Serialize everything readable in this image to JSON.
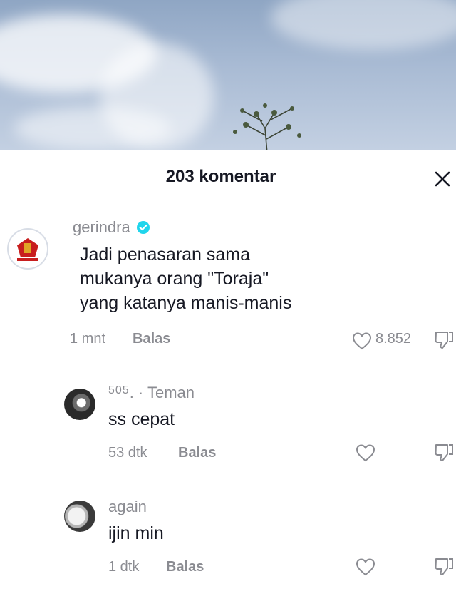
{
  "header": {
    "title": "203 komentar",
    "close_icon": "close-icon"
  },
  "comments": [
    {
      "username": "gerindra",
      "verified": true,
      "text_lines": [
        "Jadi penasaran sama",
        "mukanya orang \"Toraja\"",
        "yang katanya manis-manis"
      ],
      "time": "1 mnt",
      "reply_label": "Balas",
      "like_count": "8.852"
    },
    {
      "username": "505",
      "username_suffix": ". · Teman",
      "text": "ss cepat",
      "time": "53 dtk",
      "reply_label": "Balas"
    },
    {
      "username": "again",
      "text": "ijin min",
      "time": "1 dtk",
      "reply_label": "Balas"
    }
  ],
  "colors": {
    "text_primary": "#161823",
    "text_secondary": "#8a8b91",
    "verified": "#20d5ec"
  }
}
